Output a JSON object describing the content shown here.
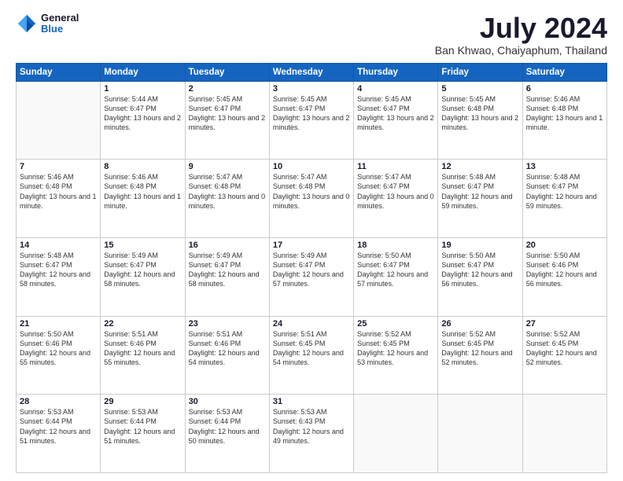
{
  "logo": {
    "line1": "General",
    "line2": "Blue"
  },
  "title": "July 2024",
  "location": "Ban Khwao, Chaiyaphum, Thailand",
  "days_header": [
    "Sunday",
    "Monday",
    "Tuesday",
    "Wednesday",
    "Thursday",
    "Friday",
    "Saturday"
  ],
  "weeks": [
    [
      {
        "day": "",
        "sunrise": "",
        "sunset": "",
        "daylight": ""
      },
      {
        "day": "1",
        "sunrise": "Sunrise: 5:44 AM",
        "sunset": "Sunset: 6:47 PM",
        "daylight": "Daylight: 13 hours and 2 minutes."
      },
      {
        "day": "2",
        "sunrise": "Sunrise: 5:45 AM",
        "sunset": "Sunset: 6:47 PM",
        "daylight": "Daylight: 13 hours and 2 minutes."
      },
      {
        "day": "3",
        "sunrise": "Sunrise: 5:45 AM",
        "sunset": "Sunset: 6:47 PM",
        "daylight": "Daylight: 13 hours and 2 minutes."
      },
      {
        "day": "4",
        "sunrise": "Sunrise: 5:45 AM",
        "sunset": "Sunset: 6:47 PM",
        "daylight": "Daylight: 13 hours and 2 minutes."
      },
      {
        "day": "5",
        "sunrise": "Sunrise: 5:45 AM",
        "sunset": "Sunset: 6:48 PM",
        "daylight": "Daylight: 13 hours and 2 minutes."
      },
      {
        "day": "6",
        "sunrise": "Sunrise: 5:46 AM",
        "sunset": "Sunset: 6:48 PM",
        "daylight": "Daylight: 13 hours and 1 minute."
      }
    ],
    [
      {
        "day": "7",
        "sunrise": "Sunrise: 5:46 AM",
        "sunset": "Sunset: 6:48 PM",
        "daylight": "Daylight: 13 hours and 1 minute."
      },
      {
        "day": "8",
        "sunrise": "Sunrise: 5:46 AM",
        "sunset": "Sunset: 6:48 PM",
        "daylight": "Daylight: 13 hours and 1 minute."
      },
      {
        "day": "9",
        "sunrise": "Sunrise: 5:47 AM",
        "sunset": "Sunset: 6:48 PM",
        "daylight": "Daylight: 13 hours and 0 minutes."
      },
      {
        "day": "10",
        "sunrise": "Sunrise: 5:47 AM",
        "sunset": "Sunset: 6:48 PM",
        "daylight": "Daylight: 13 hours and 0 minutes."
      },
      {
        "day": "11",
        "sunrise": "Sunrise: 5:47 AM",
        "sunset": "Sunset: 6:47 PM",
        "daylight": "Daylight: 13 hours and 0 minutes."
      },
      {
        "day": "12",
        "sunrise": "Sunrise: 5:48 AM",
        "sunset": "Sunset: 6:47 PM",
        "daylight": "Daylight: 12 hours and 59 minutes."
      },
      {
        "day": "13",
        "sunrise": "Sunrise: 5:48 AM",
        "sunset": "Sunset: 6:47 PM",
        "daylight": "Daylight: 12 hours and 59 minutes."
      }
    ],
    [
      {
        "day": "14",
        "sunrise": "Sunrise: 5:48 AM",
        "sunset": "Sunset: 6:47 PM",
        "daylight": "Daylight: 12 hours and 58 minutes."
      },
      {
        "day": "15",
        "sunrise": "Sunrise: 5:49 AM",
        "sunset": "Sunset: 6:47 PM",
        "daylight": "Daylight: 12 hours and 58 minutes."
      },
      {
        "day": "16",
        "sunrise": "Sunrise: 5:49 AM",
        "sunset": "Sunset: 6:47 PM",
        "daylight": "Daylight: 12 hours and 58 minutes."
      },
      {
        "day": "17",
        "sunrise": "Sunrise: 5:49 AM",
        "sunset": "Sunset: 6:47 PM",
        "daylight": "Daylight: 12 hours and 57 minutes."
      },
      {
        "day": "18",
        "sunrise": "Sunrise: 5:50 AM",
        "sunset": "Sunset: 6:47 PM",
        "daylight": "Daylight: 12 hours and 57 minutes."
      },
      {
        "day": "19",
        "sunrise": "Sunrise: 5:50 AM",
        "sunset": "Sunset: 6:47 PM",
        "daylight": "Daylight: 12 hours and 56 minutes."
      },
      {
        "day": "20",
        "sunrise": "Sunrise: 5:50 AM",
        "sunset": "Sunset: 6:46 PM",
        "daylight": "Daylight: 12 hours and 56 minutes."
      }
    ],
    [
      {
        "day": "21",
        "sunrise": "Sunrise: 5:50 AM",
        "sunset": "Sunset: 6:46 PM",
        "daylight": "Daylight: 12 hours and 55 minutes."
      },
      {
        "day": "22",
        "sunrise": "Sunrise: 5:51 AM",
        "sunset": "Sunset: 6:46 PM",
        "daylight": "Daylight: 12 hours and 55 minutes."
      },
      {
        "day": "23",
        "sunrise": "Sunrise: 5:51 AM",
        "sunset": "Sunset: 6:46 PM",
        "daylight": "Daylight: 12 hours and 54 minutes."
      },
      {
        "day": "24",
        "sunrise": "Sunrise: 5:51 AM",
        "sunset": "Sunset: 6:45 PM",
        "daylight": "Daylight: 12 hours and 54 minutes."
      },
      {
        "day": "25",
        "sunrise": "Sunrise: 5:52 AM",
        "sunset": "Sunset: 6:45 PM",
        "daylight": "Daylight: 12 hours and 53 minutes."
      },
      {
        "day": "26",
        "sunrise": "Sunrise: 5:52 AM",
        "sunset": "Sunset: 6:45 PM",
        "daylight": "Daylight: 12 hours and 52 minutes."
      },
      {
        "day": "27",
        "sunrise": "Sunrise: 5:52 AM",
        "sunset": "Sunset: 6:45 PM",
        "daylight": "Daylight: 12 hours and 52 minutes."
      }
    ],
    [
      {
        "day": "28",
        "sunrise": "Sunrise: 5:53 AM",
        "sunset": "Sunset: 6:44 PM",
        "daylight": "Daylight: 12 hours and 51 minutes."
      },
      {
        "day": "29",
        "sunrise": "Sunrise: 5:53 AM",
        "sunset": "Sunset: 6:44 PM",
        "daylight": "Daylight: 12 hours and 51 minutes."
      },
      {
        "day": "30",
        "sunrise": "Sunrise: 5:53 AM",
        "sunset": "Sunset: 6:44 PM",
        "daylight": "Daylight: 12 hours and 50 minutes."
      },
      {
        "day": "31",
        "sunrise": "Sunrise: 5:53 AM",
        "sunset": "Sunset: 6:43 PM",
        "daylight": "Daylight: 12 hours and 49 minutes."
      },
      {
        "day": "",
        "sunrise": "",
        "sunset": "",
        "daylight": ""
      },
      {
        "day": "",
        "sunrise": "",
        "sunset": "",
        "daylight": ""
      },
      {
        "day": "",
        "sunrise": "",
        "sunset": "",
        "daylight": ""
      }
    ]
  ]
}
